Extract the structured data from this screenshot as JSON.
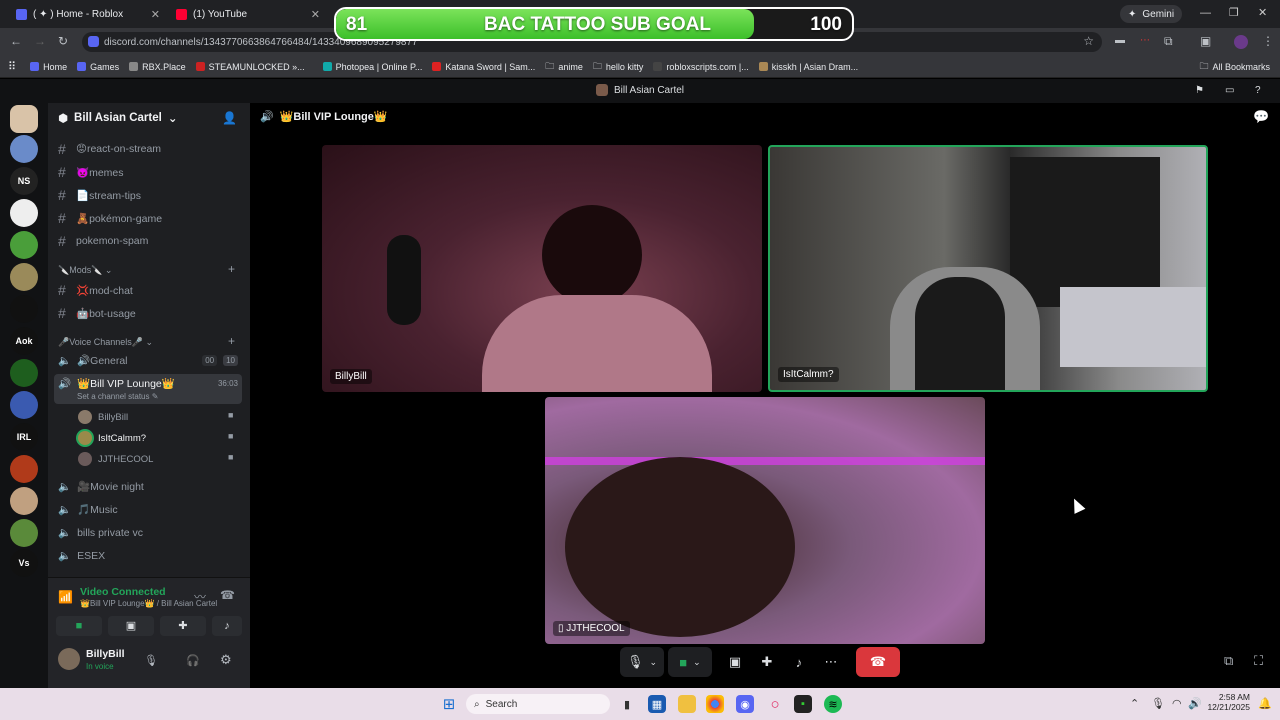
{
  "browser": {
    "tabs": [
      {
        "title": "( ✦ ) Home - Roblox"
      },
      {
        "title": "(1) YouTube"
      }
    ],
    "url": "discord.com/channels/1343770663864766484/1433409689095279877",
    "profile_label": "Gemini",
    "bookmarks": [
      "Home",
      "Games",
      "RBX.Place",
      "STEAMUNLOCKED »...",
      "Photopea | Online P...",
      "Katana Sword | Sam...",
      "anime",
      "hello kitty",
      "robloxscripts.com |...",
      "kisskh | Asian Dram..."
    ],
    "all_bookmarks": "All Bookmarks"
  },
  "goal_overlay": {
    "current": "81",
    "label": "BAC TATTOO SUB GOAL",
    "target": "100",
    "progress_fraction": 0.81
  },
  "discord": {
    "window_title": "Bill Asian Cartel",
    "server_name": "Bill Asian Cartel",
    "servers": [
      "",
      "",
      "NS",
      "",
      "",
      "",
      "",
      "Aok",
      "",
      "",
      "IRL",
      "",
      "",
      "Vs"
    ],
    "channels": [
      {
        "name": "😡react-on-stream"
      },
      {
        "name": "👿memes"
      },
      {
        "name": "📄stream-tips"
      },
      {
        "name": "🧸pokémon-game"
      },
      {
        "name": "pokemon-spam"
      }
    ],
    "mods_category": "🔪Mods🔪",
    "mod_channels": [
      {
        "name": "💢mod-chat"
      },
      {
        "name": "🤖bot-usage"
      }
    ],
    "voice_category": "🎤Voice Channels🎤",
    "voice_channels": {
      "general": {
        "name": "🔊General",
        "count_a": "00",
        "count_b": "10"
      },
      "vip": {
        "name": "👑Bill VIP Lounge👑",
        "time": "36:03",
        "status": "Set a channel status"
      },
      "vip_users": [
        "BillyBill",
        "IsItCalmm?",
        "JJTHECOOL"
      ],
      "others": [
        "🎥Movie night",
        "🎵Music",
        "bills private vc",
        "ESEX"
      ]
    },
    "connection": {
      "status": "Video Connected",
      "location": "👑Bill VIP Lounge👑 / Bill Asian Cartel"
    },
    "self": {
      "name": "BillyBill",
      "status": "In voice"
    },
    "stage_header": "👑Bill VIP Lounge👑",
    "tiles": [
      {
        "name": "BillyBill"
      },
      {
        "name": "IsItCalmm?"
      },
      {
        "name": "JJTHECOOL"
      }
    ]
  },
  "taskbar": {
    "search": "Search",
    "time": "2:58 AM",
    "date": "12/21/2025"
  }
}
